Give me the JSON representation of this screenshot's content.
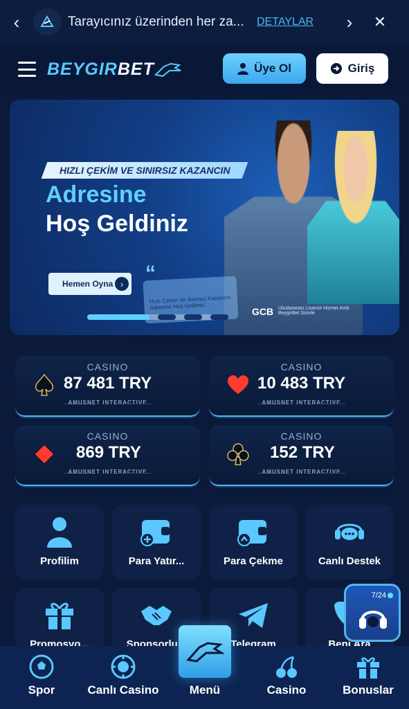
{
  "notification": {
    "message": "Tarayıcınız üzerinden her za...",
    "details_link": "DETAYLAR"
  },
  "header": {
    "logo_part1": "BEYGIR",
    "logo_part2": "BET",
    "register_label": "Üye Ol",
    "login_label": "Giriş"
  },
  "banner": {
    "ribbon": "HIZLI ÇEKİM VE SINIRSIZ KAZANCIN",
    "headline_1": "Adresine",
    "headline_2": "Hoş Geldiniz",
    "cta_label": "Hemen Oyna",
    "card_text": "Hızlı Çekim Ve Sınırsız Kazancın Adresine Hoş Geldiniz.",
    "gcb_label": "GCB",
    "license_text": "Uluslararası Lisanslı Hizmet Artık BeygirBet Sizinle",
    "slide_progress": 0.45
  },
  "jackpots": [
    {
      "category": "CASINO",
      "suit": "spade",
      "amount": "87 481 TRY",
      "provider": "AMUSNET INTERACTIVE"
    },
    {
      "category": "CASINO",
      "suit": "heart",
      "amount": "10 483 TRY",
      "provider": "AMUSNET INTERACTIVE"
    },
    {
      "category": "CASINO",
      "suit": "diamond",
      "amount": "869 TRY",
      "provider": "AMUSNET INTERACTIVE"
    },
    {
      "category": "CASINO",
      "suit": "club",
      "amount": "152 TRY",
      "provider": "AMUSNET INTERACTIVE"
    }
  ],
  "tiles": [
    {
      "label": "Profilim",
      "icon": "user-icon"
    },
    {
      "label": "Para Yatır...",
      "icon": "wallet-plus-icon"
    },
    {
      "label": "Para Çekme",
      "icon": "wallet-withdraw-icon"
    },
    {
      "label": "Canlı Destek",
      "icon": "chat-support-icon"
    },
    {
      "label": "Promosyo...",
      "icon": "gift-icon"
    },
    {
      "label": "Sponsorlu...",
      "icon": "handshake-icon"
    },
    {
      "label": "Telegram",
      "icon": "telegram-icon"
    },
    {
      "label": "Beni Ara",
      "icon": "phone-icon"
    }
  ],
  "widget": {
    "count": "7/24"
  },
  "bottom_nav": {
    "spor": "Spor",
    "canli_casino": "Canlı Casino",
    "menu": "Menü",
    "casino": "Casino",
    "bonuslar": "Bonuslar"
  },
  "colors": {
    "background": "#0b1a3a",
    "accent": "#4fb7ee",
    "tile": "#0f2147",
    "heart": "#ff3b30"
  }
}
